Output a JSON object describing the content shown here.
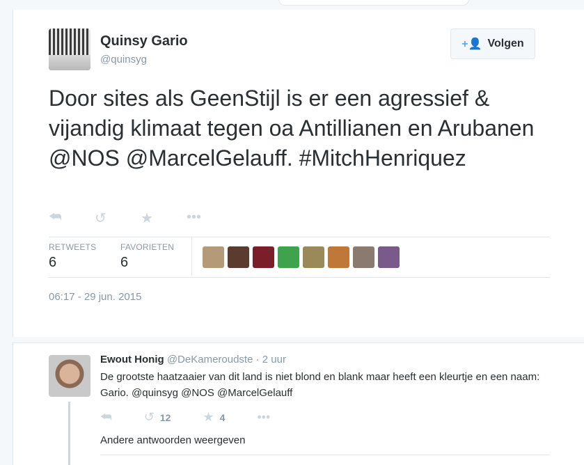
{
  "tweet": {
    "author_name": "Quinsy Gario",
    "author_handle": "@quinsyg",
    "follow_label": "Volgen",
    "text": "Door sites als GeenStijl is er een agressief & vijandig klimaat tegen oa Antillianen en Arubanen @NOS @MarcelGelauff. #MitchHenriquez",
    "stats": {
      "retweets_label": "RETWEETS",
      "retweets_count": "6",
      "favorites_label": "FAVORIETEN",
      "favorites_count": "6"
    },
    "timestamp": "06:17 - 29 jun. 2015",
    "icons": {
      "reply": "reply-icon",
      "retweet": "retweet-icon",
      "favorite": "star-icon",
      "more": "more-icon",
      "follow": "add-user-icon"
    },
    "favoriter_avatar_colors": [
      "#b59a78",
      "#5a3b2e",
      "#7a1f2a",
      "#3fa34d",
      "#9a8a5a",
      "#c07838",
      "#8a7a70",
      "#7a5a8a"
    ]
  },
  "reply": {
    "author_name": "Ewout Honig",
    "author_handle": "@DeKameroudste",
    "time": "· 2 uur",
    "text": "De grootste haatzaaier van dit land is niet blond en blank maar heeft een kleurtje en een naam: Gario. @quinsyg @NOS @MarcelGelauff",
    "retweet_count": "12",
    "favorite_count": "4",
    "more_replies_label": "Andere antwoorden weergeven"
  },
  "colors": {
    "accent": "#55acee",
    "muted": "#8899a6",
    "text": "#292f33",
    "border": "#e1e8ed"
  }
}
